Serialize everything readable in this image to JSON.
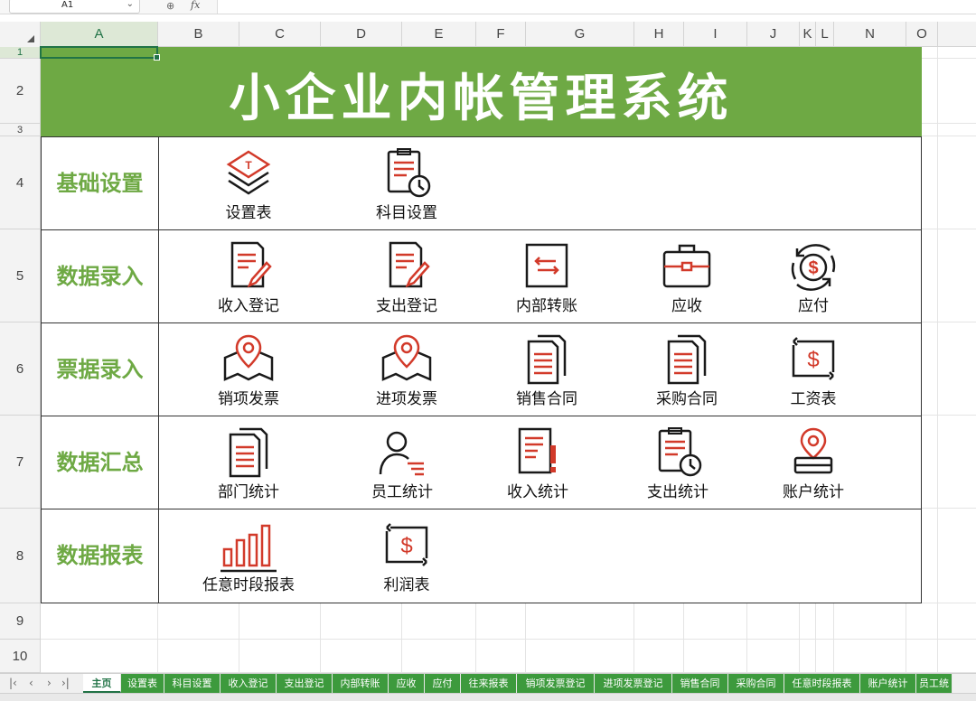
{
  "formula_bar": {
    "cell_ref": "A1",
    "fx_label": "fx",
    "formula": ""
  },
  "columns": [
    "A",
    "B",
    "C",
    "D",
    "E",
    "F",
    "G",
    "H",
    "I",
    "J",
    "K",
    "L",
    "N",
    "O"
  ],
  "rows": [
    "1",
    "2",
    "3",
    "4",
    "5",
    "6",
    "7",
    "8",
    "9",
    "10"
  ],
  "title": "小企业内帐管理系统",
  "categories": [
    {
      "label": "基础设置",
      "items": [
        {
          "label": "设置表",
          "icon": "layers-icon"
        },
        {
          "label": "科目设置",
          "icon": "clipboard-clock-icon"
        }
      ]
    },
    {
      "label": "数据录入",
      "items": [
        {
          "label": "收入登记",
          "icon": "document-pen-icon"
        },
        {
          "label": "支出登记",
          "icon": "document-pen-icon"
        },
        {
          "label": "内部转账",
          "icon": "transfer-icon"
        },
        {
          "label": "应收",
          "icon": "briefcase-icon"
        },
        {
          "label": "应付",
          "icon": "dollar-cycle-icon"
        }
      ]
    },
    {
      "label": "票据录入",
      "items": [
        {
          "label": "销项发票",
          "icon": "map-pin-icon"
        },
        {
          "label": "进项发票",
          "icon": "map-pin-icon"
        },
        {
          "label": "销售合同",
          "icon": "stacked-document-icon"
        },
        {
          "label": "采购合同",
          "icon": "stacked-document-icon"
        },
        {
          "label": "工资表",
          "icon": "dollar-transfer-icon"
        }
      ]
    },
    {
      "label": "数据汇总",
      "items": [
        {
          "label": "部门统计",
          "icon": "stacked-document-icon"
        },
        {
          "label": "员工统计",
          "icon": "user-list-icon"
        },
        {
          "label": "收入统计",
          "icon": "document-alert-icon"
        },
        {
          "label": "支出统计",
          "icon": "clipboard-clock-icon"
        },
        {
          "label": "账户统计",
          "icon": "location-card-icon"
        }
      ]
    },
    {
      "label": "数据报表",
      "items": [
        {
          "label": "任意时段报表",
          "icon": "bar-chart-icon"
        },
        {
          "label": "利润表",
          "icon": "dollar-transfer-icon"
        }
      ]
    }
  ],
  "sheet_tabs": [
    "主页",
    "设置表",
    "科目设置",
    "收入登记",
    "支出登记",
    "内部转账",
    "应收",
    "应付",
    "往来报表",
    "销项发票登记",
    "进项发票登记",
    "销售合同",
    "采购合同",
    "任意时段报表",
    "账户统计",
    "员工统"
  ],
  "colors": {
    "accent_green": "#6ea944",
    "icon_red": "#d23a2a",
    "tab_green": "#3d9a3d"
  }
}
